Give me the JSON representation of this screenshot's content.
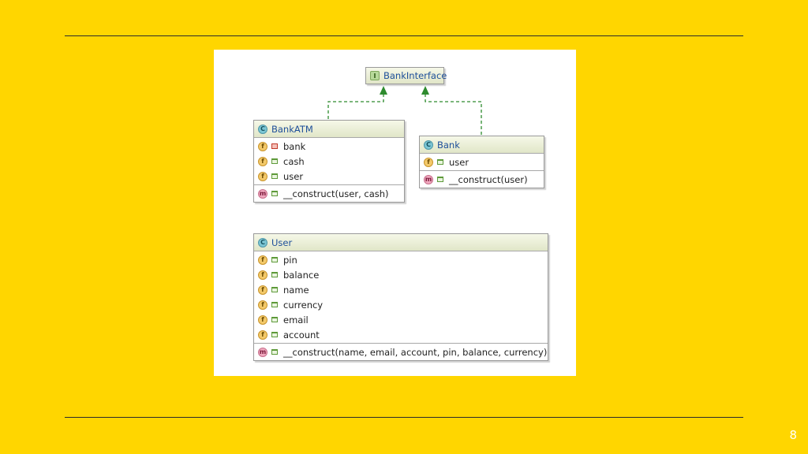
{
  "colors": {
    "background": "#FFD600",
    "arrow": "#2e8b2e",
    "class_title": "#1e4f9a"
  },
  "page_number": "8",
  "diagram": {
    "interface": {
      "badge": "I",
      "name": "BankInterface"
    },
    "classes": {
      "bank_atm": {
        "badge": "C",
        "name": "BankATM",
        "fields": [
          {
            "badge": "f",
            "visibility": "private",
            "name": "bank"
          },
          {
            "badge": "f",
            "visibility": "public",
            "name": "cash"
          },
          {
            "badge": "f",
            "visibility": "public",
            "name": "user"
          }
        ],
        "methods": [
          {
            "badge": "m",
            "visibility": "public",
            "name": "__construct(user, cash)"
          }
        ]
      },
      "bank": {
        "badge": "C",
        "name": "Bank",
        "fields": [
          {
            "badge": "f",
            "visibility": "public",
            "name": "user"
          }
        ],
        "methods": [
          {
            "badge": "m",
            "visibility": "public",
            "name": "__construct(user)"
          }
        ]
      },
      "user": {
        "badge": "C",
        "name": "User",
        "fields": [
          {
            "badge": "f",
            "visibility": "public",
            "name": "pin"
          },
          {
            "badge": "f",
            "visibility": "public",
            "name": "balance"
          },
          {
            "badge": "f",
            "visibility": "public",
            "name": "name"
          },
          {
            "badge": "f",
            "visibility": "public",
            "name": "currency"
          },
          {
            "badge": "f",
            "visibility": "public",
            "name": "email"
          },
          {
            "badge": "f",
            "visibility": "public",
            "name": "account"
          }
        ],
        "methods": [
          {
            "badge": "m",
            "visibility": "public",
            "name": "__construct(name, email, account, pin, balance, currency)"
          }
        ]
      }
    }
  }
}
